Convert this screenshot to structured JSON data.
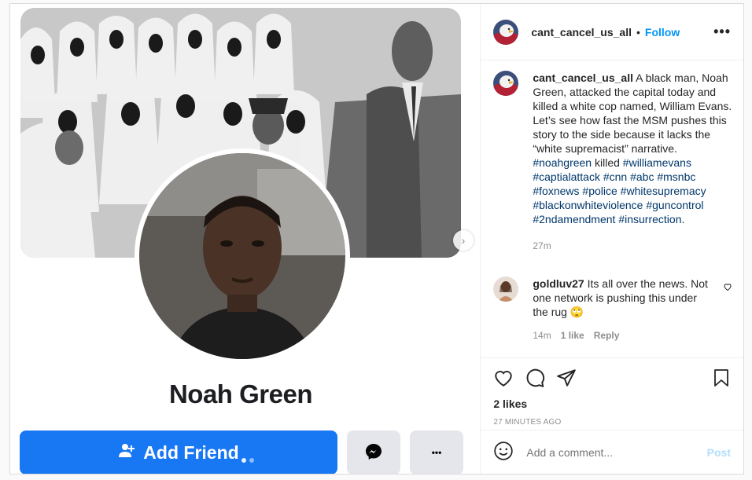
{
  "media": {
    "profile_name": "Noah Green",
    "add_friend_label": "Add Friend",
    "more_label": "•••"
  },
  "post": {
    "username": "cant_cancel_us_all",
    "separator": "•",
    "follow_label": "Follow",
    "options": "•••",
    "caption": {
      "username": "cant_cancel_us_all",
      "text": "A black man, Noah Green, attacked the capital today and killed a white cop named, William Evans. Let’s see how fast the MSM pushes this story to the side because it lacks the “white supremacist” narrative.",
      "tag1": "#noahgreen",
      "word_killed": "killed",
      "tags": [
        "#williamevans",
        "#captialattack",
        "#cnn",
        "#abc",
        "#msnbc",
        "#foxnews",
        "#police",
        "#whitesupremacy",
        "#blackonwhiteviolence",
        "#guncontrol",
        "#2ndamendment",
        "#insurrection"
      ],
      "period": ".",
      "time": "27m"
    },
    "comment": {
      "username": "goldluv27",
      "text": "Its all over the news. Not one network is pushing this under the rug 🙄",
      "time": "14m",
      "likes": "1 like",
      "reply": "Reply"
    },
    "likes": "2 likes",
    "ago": "27 MINUTES AGO",
    "add_comment_placeholder": "Add a comment...",
    "post_label": "Post"
  }
}
